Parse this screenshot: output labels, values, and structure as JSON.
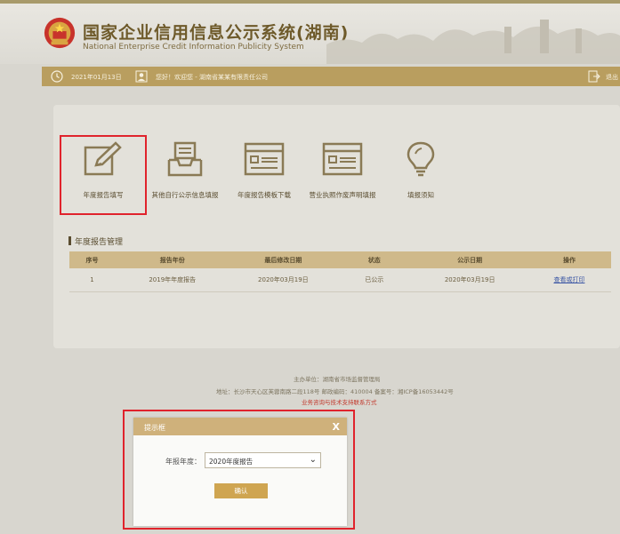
{
  "header": {
    "title_cn": "国家企业信用信息公示系统(湖南)",
    "title_en": "National Enterprise Credit Information Publicity System"
  },
  "infobar": {
    "date": "2021年01月13日",
    "greeting": "您好！欢迎您 - 湖南省某某有限责任公司",
    "exit_label": "退出"
  },
  "tools": [
    {
      "label": "年度报告填写",
      "icon": "edit-icon"
    },
    {
      "label": "其他自行公示信息填报",
      "icon": "inbox-icon"
    },
    {
      "label": "年度报告模板下载",
      "icon": "template-icon"
    },
    {
      "label": "营业执照作废声明填报",
      "icon": "license-icon"
    },
    {
      "label": "填报须知",
      "icon": "lightbulb-icon"
    }
  ],
  "section": {
    "title": "年度报告管理"
  },
  "table": {
    "headers": [
      "序号",
      "报告年份",
      "最后修改日期",
      "状态",
      "公示日期",
      "操作"
    ],
    "rows": [
      {
        "no": "1",
        "year": "2019年年度报告",
        "modified": "2020年03月19日",
        "status": "已公示",
        "published": "2020年03月19日",
        "action": "查看或打印"
      }
    ]
  },
  "footer": {
    "line1": "主办单位：湖南省市场监督管理局",
    "line2": "地址：长沙市天心区芙蓉南路二段118号  邮政编码：410004  备案号：湘ICP备16053442号",
    "line3": "业务咨询与技术支持联系方式"
  },
  "dialog": {
    "title": "提示框",
    "close": "X",
    "field_label": "年报年度：",
    "selected": "2020年度报告",
    "confirm": "确认"
  },
  "colors": {
    "accent": "#b99e5f",
    "highlight": "#e0232c",
    "link": "#3b56a4"
  }
}
